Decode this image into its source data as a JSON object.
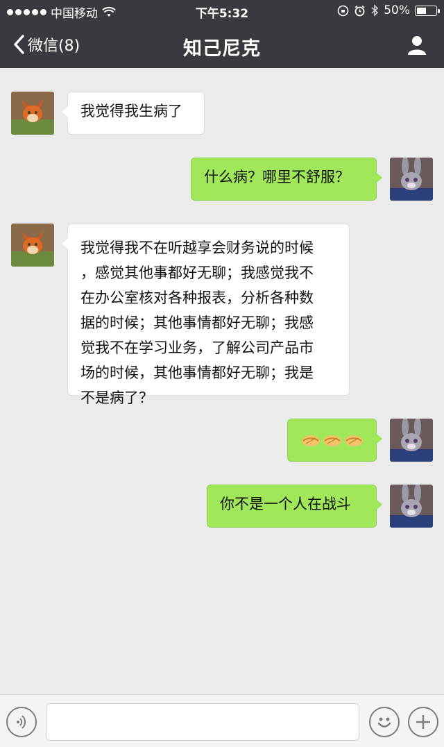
{
  "status": {
    "carrier": "中国移动",
    "time": "下午5:32",
    "battery": "50%",
    "battery_level": 0.5
  },
  "nav": {
    "back_label": "微信(8)",
    "title": "知己尼克"
  },
  "messages": [
    {
      "side": "in",
      "text": "我觉得我生病了"
    },
    {
      "side": "out",
      "text": "什么病？哪里不舒服？"
    },
    {
      "side": "in",
      "lines": [
        "我觉得我不在听越享会财务说的时候",
        "，感觉其他事都好无聊；我感觉我不",
        "在办公室核对各种报表，分析各种数",
        "据的时候；其他事情都好无聊；我感",
        "觉我不在学习业务，了解公司产品市",
        "场的时候，其他事情都好无聊；我是",
        "不是病了？"
      ]
    },
    {
      "side": "out",
      "emoji": "handshake-emoji-x3"
    },
    {
      "side": "out",
      "text": "你不是一个人在战斗"
    }
  ],
  "colors": {
    "nav_bg": "#393a3f",
    "chat_bg": "#ebebeb",
    "out_bubble": "#a0e75a",
    "in_bubble": "#ffffff"
  }
}
